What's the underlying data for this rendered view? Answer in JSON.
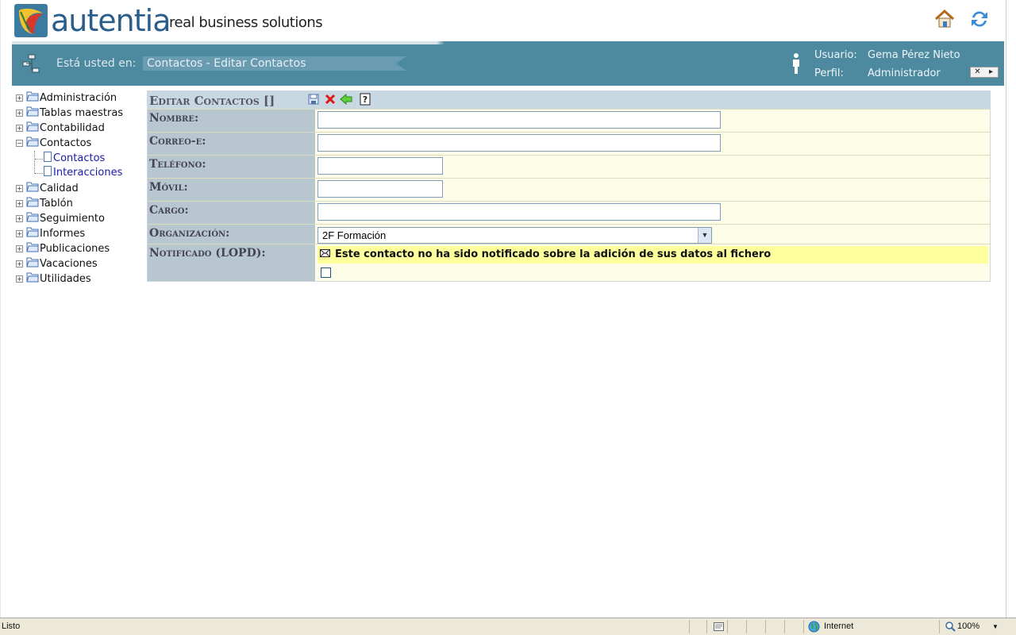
{
  "header": {
    "logo_text": "autentia",
    "tagline": "real business solutions"
  },
  "navbar": {
    "where_label": "Está usted en:",
    "breadcrumb": "Contactos - Editar Contactos",
    "user_label": "Usuario:",
    "user_value": "Gema Pérez Nieto",
    "profile_label": "Perfil:",
    "profile_value": "Administrador"
  },
  "tree": {
    "items": [
      {
        "label": "Administración",
        "expanded": false
      },
      {
        "label": "Tablas maestras",
        "expanded": false
      },
      {
        "label": "Contabilidad",
        "expanded": false
      },
      {
        "label": "Contactos",
        "expanded": true
      },
      {
        "label": "Calidad",
        "expanded": false
      },
      {
        "label": "Tablón",
        "expanded": false
      },
      {
        "label": "Seguimiento",
        "expanded": false
      },
      {
        "label": "Informes",
        "expanded": false
      },
      {
        "label": "Publicaciones",
        "expanded": false
      },
      {
        "label": "Vacaciones",
        "expanded": false
      },
      {
        "label": "Utilidades",
        "expanded": false
      }
    ],
    "contactos_children": [
      "Contactos",
      "Interacciones"
    ]
  },
  "form": {
    "title": "Editar Contactos []",
    "fields": {
      "nombre": {
        "label": "Nombre:",
        "value": ""
      },
      "correo": {
        "label": "Correo-e:",
        "value": ""
      },
      "telefono": {
        "label": "Teléfono:",
        "value": ""
      },
      "movil": {
        "label": "Móvil:",
        "value": ""
      },
      "cargo": {
        "label": "Cargo:",
        "value": ""
      },
      "organizacion": {
        "label": "Organización:",
        "value": "2F Formación"
      },
      "notificado": {
        "label": "Notificado (LOPD):",
        "notice": "Este contacto no ha sido notificado sobre la adición de sus datos al fichero",
        "checked": false
      }
    }
  },
  "statusbar": {
    "status": "Listo",
    "zone": "Internet",
    "zoom": "100%"
  },
  "colors": {
    "navbar": "#4d8aa0",
    "form_label_bg": "#b8c6cf",
    "form_bg": "#fefee8",
    "notice_bg": "#ffff9d"
  }
}
